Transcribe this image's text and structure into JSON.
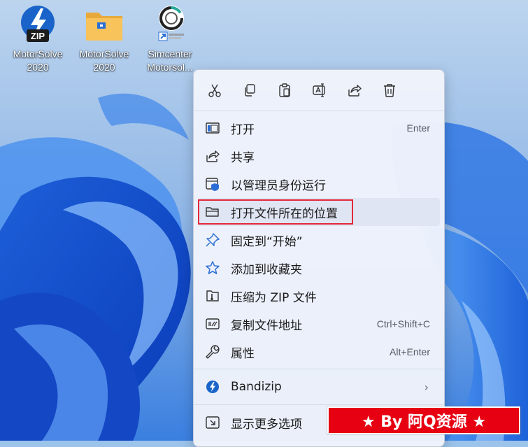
{
  "desktop": {
    "icons": [
      {
        "line1": "MotorSolve",
        "line2": "2020",
        "icon": "zip-archive-icon",
        "badge": "ZIP"
      },
      {
        "line1": "MotorSolve",
        "line2": "2020",
        "icon": "folder-icon"
      },
      {
        "line1": "Simcenter",
        "line2": "Motorsol...",
        "icon": "simcenter-app-icon"
      }
    ]
  },
  "context_menu": {
    "quick_actions": [
      {
        "name": "cut",
        "icon": "scissors-icon"
      },
      {
        "name": "copy",
        "icon": "copy-icon"
      },
      {
        "name": "paste",
        "icon": "clipboard-icon"
      },
      {
        "name": "rename",
        "icon": "rename-icon"
      },
      {
        "name": "share",
        "icon": "share-icon"
      },
      {
        "name": "delete",
        "icon": "trash-icon"
      }
    ],
    "items": [
      {
        "label": "打开",
        "shortcut": "Enter",
        "icon": "open-window-icon"
      },
      {
        "label": "共享",
        "shortcut": "",
        "icon": "share-icon"
      },
      {
        "label": "以管理员身份运行",
        "shortcut": "",
        "icon": "shield-admin-icon"
      },
      {
        "label": "打开文件所在的位置",
        "shortcut": "",
        "icon": "folder-open-icon",
        "highlighted": true
      },
      {
        "label": "固定到“开始”",
        "shortcut": "",
        "icon": "pin-icon"
      },
      {
        "label": "添加到收藏夹",
        "shortcut": "",
        "icon": "star-icon"
      },
      {
        "label": "压缩为 ZIP 文件",
        "shortcut": "",
        "icon": "zip-compress-icon"
      },
      {
        "label": "复制文件地址",
        "shortcut": "Ctrl+Shift+C",
        "icon": "copy-path-icon"
      },
      {
        "label": "属性",
        "shortcut": "Alt+Enter",
        "icon": "wrench-icon"
      }
    ],
    "submenu_item": {
      "label": "Bandizip",
      "icon": "bandizip-icon",
      "chevron": "›"
    },
    "more_options": {
      "label": "显示更多选项",
      "icon": "more-options-icon"
    }
  },
  "watermark": {
    "text": "★ By 阿Q资源 ★"
  },
  "colors": {
    "accent": "#2b6fd6",
    "highlight_border": "#e3293a",
    "watermark_bg": "#e60012"
  }
}
